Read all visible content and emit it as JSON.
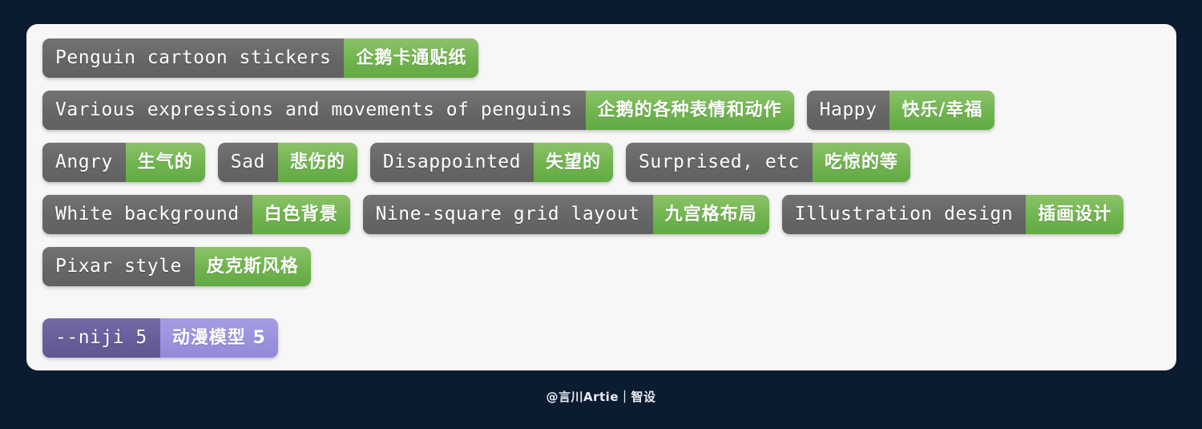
{
  "theme": {
    "page_background": "#0b1b30",
    "card_background": "#f7f7f7",
    "tag_en_color": "#666666",
    "tag_cn_color": "#71b44f",
    "param_en_color": "#685d99",
    "param_cn_color": "#9992dd",
    "tag_text_color": "#ffffff"
  },
  "card": {
    "rows": [
      {
        "row_name": "subject-row",
        "tags": [
          {
            "en": "Penguin cartoon stickers",
            "cn": "企鹅卡通贴纸",
            "style": "green"
          }
        ]
      },
      {
        "row_name": "expression-row",
        "tags": [
          {
            "en": "Various expressions and movements of penguins",
            "cn": "企鹅的各种表情和动作",
            "style": "green"
          },
          {
            "en": "Happy",
            "cn": "快乐/幸福",
            "style": "green"
          }
        ]
      },
      {
        "row_name": "emotions-row",
        "tags": [
          {
            "en": "Angry",
            "cn": "生气的",
            "style": "green"
          },
          {
            "en": "Sad",
            "cn": "悲伤的",
            "style": "green"
          },
          {
            "en": "Disappointed",
            "cn": "失望的",
            "style": "green"
          },
          {
            "en": "Surprised, etc",
            "cn": "吃惊的等",
            "style": "green"
          }
        ]
      },
      {
        "row_name": "composition-row",
        "tags": [
          {
            "en": "White background",
            "cn": "白色背景",
            "style": "green"
          },
          {
            "en": "Nine-square grid layout",
            "cn": "九宫格布局",
            "style": "green"
          },
          {
            "en": "Illustration design",
            "cn": "插画设计",
            "style": "green"
          }
        ]
      },
      {
        "row_name": "style-row",
        "tags": [
          {
            "en": "Pixar style",
            "cn": "皮克斯风格",
            "style": "green"
          }
        ]
      },
      {
        "row_name": "parameter-row",
        "spaced": true,
        "tags": [
          {
            "en": "--niji 5",
            "cn": "动漫模型 5",
            "style": "purple"
          }
        ]
      }
    ]
  },
  "footer": {
    "credit": "@言川Artie｜智设"
  }
}
